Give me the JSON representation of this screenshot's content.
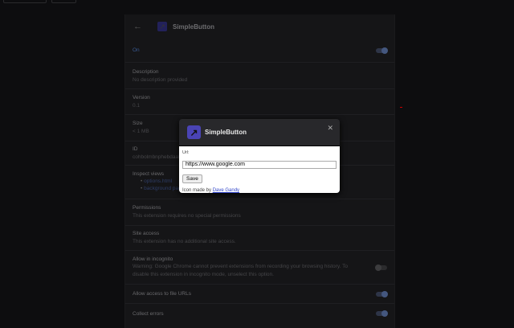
{
  "header": {
    "back_icon": "arrow-left-icon",
    "title": "SimpleButton"
  },
  "details": {
    "on_label": "On",
    "description_label": "Description",
    "description_value": "No description provided",
    "version_label": "Version",
    "version_value": "0.1",
    "size_label": "Size",
    "size_value": "< 1 MB",
    "id_label": "ID",
    "id_value": "cohbolmbnphebdaal",
    "inspect_label": "Inspect views",
    "inspect_links": [
      "options.html",
      "background page"
    ],
    "permissions_label": "Permissions",
    "permissions_value": "This extension requires no special permissions",
    "site_label": "Site access",
    "site_value": "This extension has no additional site access.",
    "incognito_label": "Allow in incognito",
    "incognito_value": "Warning: Google Chrome cannot prevent extensions from recording your browsing history. To disable this extension in incognito mode, unselect this option.",
    "file_urls_label": "Allow access to file URLs",
    "errors_label": "Collect errors"
  },
  "dialog": {
    "title": "SimpleButton",
    "url_label": "Url:",
    "url_value": "https://www.google.com",
    "save_label": "Save",
    "credit_prefix": "Icon made by",
    "credit_link": "Dave Gandy"
  },
  "colors": {
    "accent": "#4a44b5",
    "toggle_on": "#44577f"
  }
}
